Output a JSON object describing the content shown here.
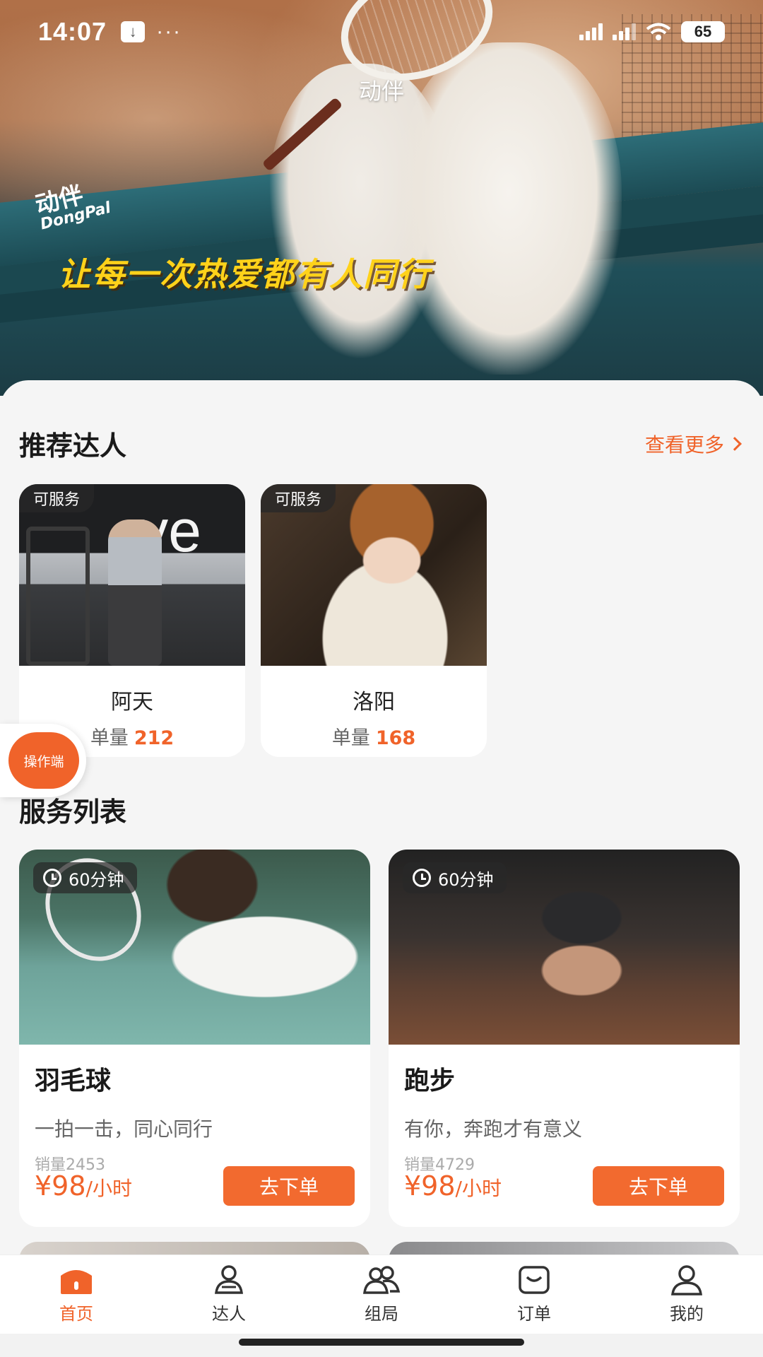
{
  "status_bar": {
    "time": "14:07",
    "dots": "···",
    "battery": "65"
  },
  "hero": {
    "app_title": "动伴",
    "logo_cn": "动伴",
    "logo_en": "DongPal",
    "slogan": "让每一次热爱都有人同行"
  },
  "recommended": {
    "title": "推荐达人",
    "more_label": "查看更多",
    "experts": [
      {
        "badge": "可服务",
        "name": "阿天",
        "orders_label": "单量",
        "orders": "212",
        "photo_text": "ve"
      },
      {
        "badge": "可服务",
        "name": "洛阳",
        "orders_label": "单量",
        "orders": "168"
      }
    ]
  },
  "float_button": {
    "label": "操作端"
  },
  "services": {
    "title": "服务列表",
    "items": [
      {
        "duration": "60分钟",
        "name": "羽毛球",
        "desc": "一拍一击，同心同行",
        "sales": "销量2453",
        "price": "¥98",
        "unit": "/小时",
        "button": "去下单"
      },
      {
        "duration": "60分钟",
        "name": "跑步",
        "desc": "有你，奔跑才有意义",
        "sales": "销量4729",
        "price": "¥98",
        "unit": "/小时",
        "button": "去下单"
      }
    ]
  },
  "tabbar": {
    "items": [
      {
        "label": "首页",
        "icon": "home-icon",
        "active": true
      },
      {
        "label": "达人",
        "icon": "expert-icon"
      },
      {
        "label": "组局",
        "icon": "group-icon"
      },
      {
        "label": "订单",
        "icon": "order-icon"
      },
      {
        "label": "我的",
        "icon": "profile-icon"
      }
    ]
  },
  "colors": {
    "accent": "#f0632a",
    "slogan": "#ffd21a",
    "background": "#f5f5f5"
  }
}
